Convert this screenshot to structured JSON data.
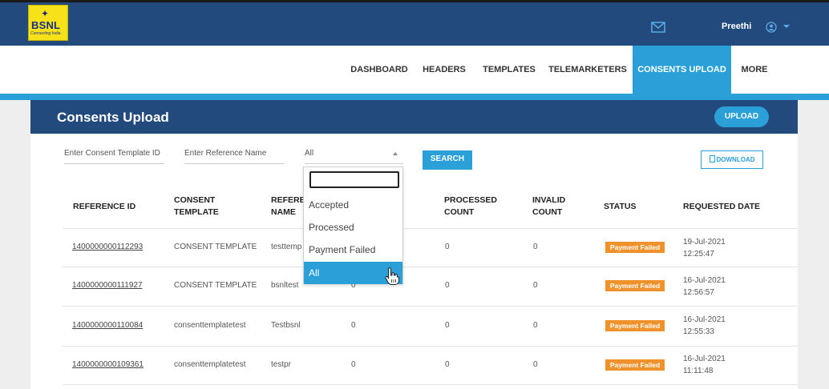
{
  "header": {
    "logo_text": "BSNL",
    "logo_tagline": "Connecting India",
    "user_name": "Preethi",
    "icons": {
      "mail": "mail-icon",
      "user": "user-icon",
      "caret": "caret-down-icon"
    }
  },
  "nav": {
    "items": [
      {
        "label": "DASHBOARD"
      },
      {
        "label": "HEADERS"
      },
      {
        "label": "TEMPLATES"
      },
      {
        "label": "TELEMARKETERS"
      },
      {
        "label": "CONSENTS UPLOAD"
      },
      {
        "label": "MORE"
      }
    ],
    "active": "CONSENTS UPLOAD"
  },
  "page": {
    "title": "Consents Upload",
    "upload_label": "UPLOAD"
  },
  "filters": {
    "template_id_placeholder": "Enter Consent Template ID",
    "reference_name_placeholder": "Enter Reference Name",
    "status_selected": "All",
    "search_label": "SEARCH",
    "download_label": "DOWNLOAD"
  },
  "dropdown": {
    "options": [
      "Accepted",
      "Processed",
      "Payment Failed",
      "All"
    ],
    "selected": "All"
  },
  "table": {
    "headers": [
      "REFERENCE ID",
      "CONSENT TEMPLATE",
      "REFEREN NAME",
      "PROCESSED COUNT",
      "INVALID COUNT",
      "STATUS",
      "REQUESTED DATE"
    ],
    "rows": [
      {
        "ref_id": "1400000000112293",
        "template": "CONSENT TEMPLATE",
        "name": "testtemp",
        "count": "",
        "processed": "0",
        "invalid": "0",
        "status": "Payment Failed",
        "date": "19-Jul-2021",
        "time": "12:25:47"
      },
      {
        "ref_id": "1400000000111927",
        "template": "CONSENT TEMPLATE",
        "name": "bsnltest",
        "count": "0",
        "processed": "0",
        "invalid": "0",
        "status": "Payment Failed",
        "date": "16-Jul-2021",
        "time": "12:56:57"
      },
      {
        "ref_id": "1400000000110084",
        "template": "consenttemplatetest",
        "name": "Testbsnl",
        "count": "0",
        "processed": "0",
        "invalid": "0",
        "status": "Payment Failed",
        "date": "16-Jul-2021",
        "time": "12:55:33"
      },
      {
        "ref_id": "1400000000109361",
        "template": "consenttemplatetest",
        "name": "testpr",
        "count": "0",
        "processed": "0",
        "invalid": "0",
        "status": "Payment Failed",
        "date": "16-Jul-2021",
        "time": "11:11:48"
      }
    ]
  },
  "colors": {
    "primary_dark": "#234a7c",
    "accent": "#2a9fd8",
    "status_failed": "#f0922b"
  }
}
